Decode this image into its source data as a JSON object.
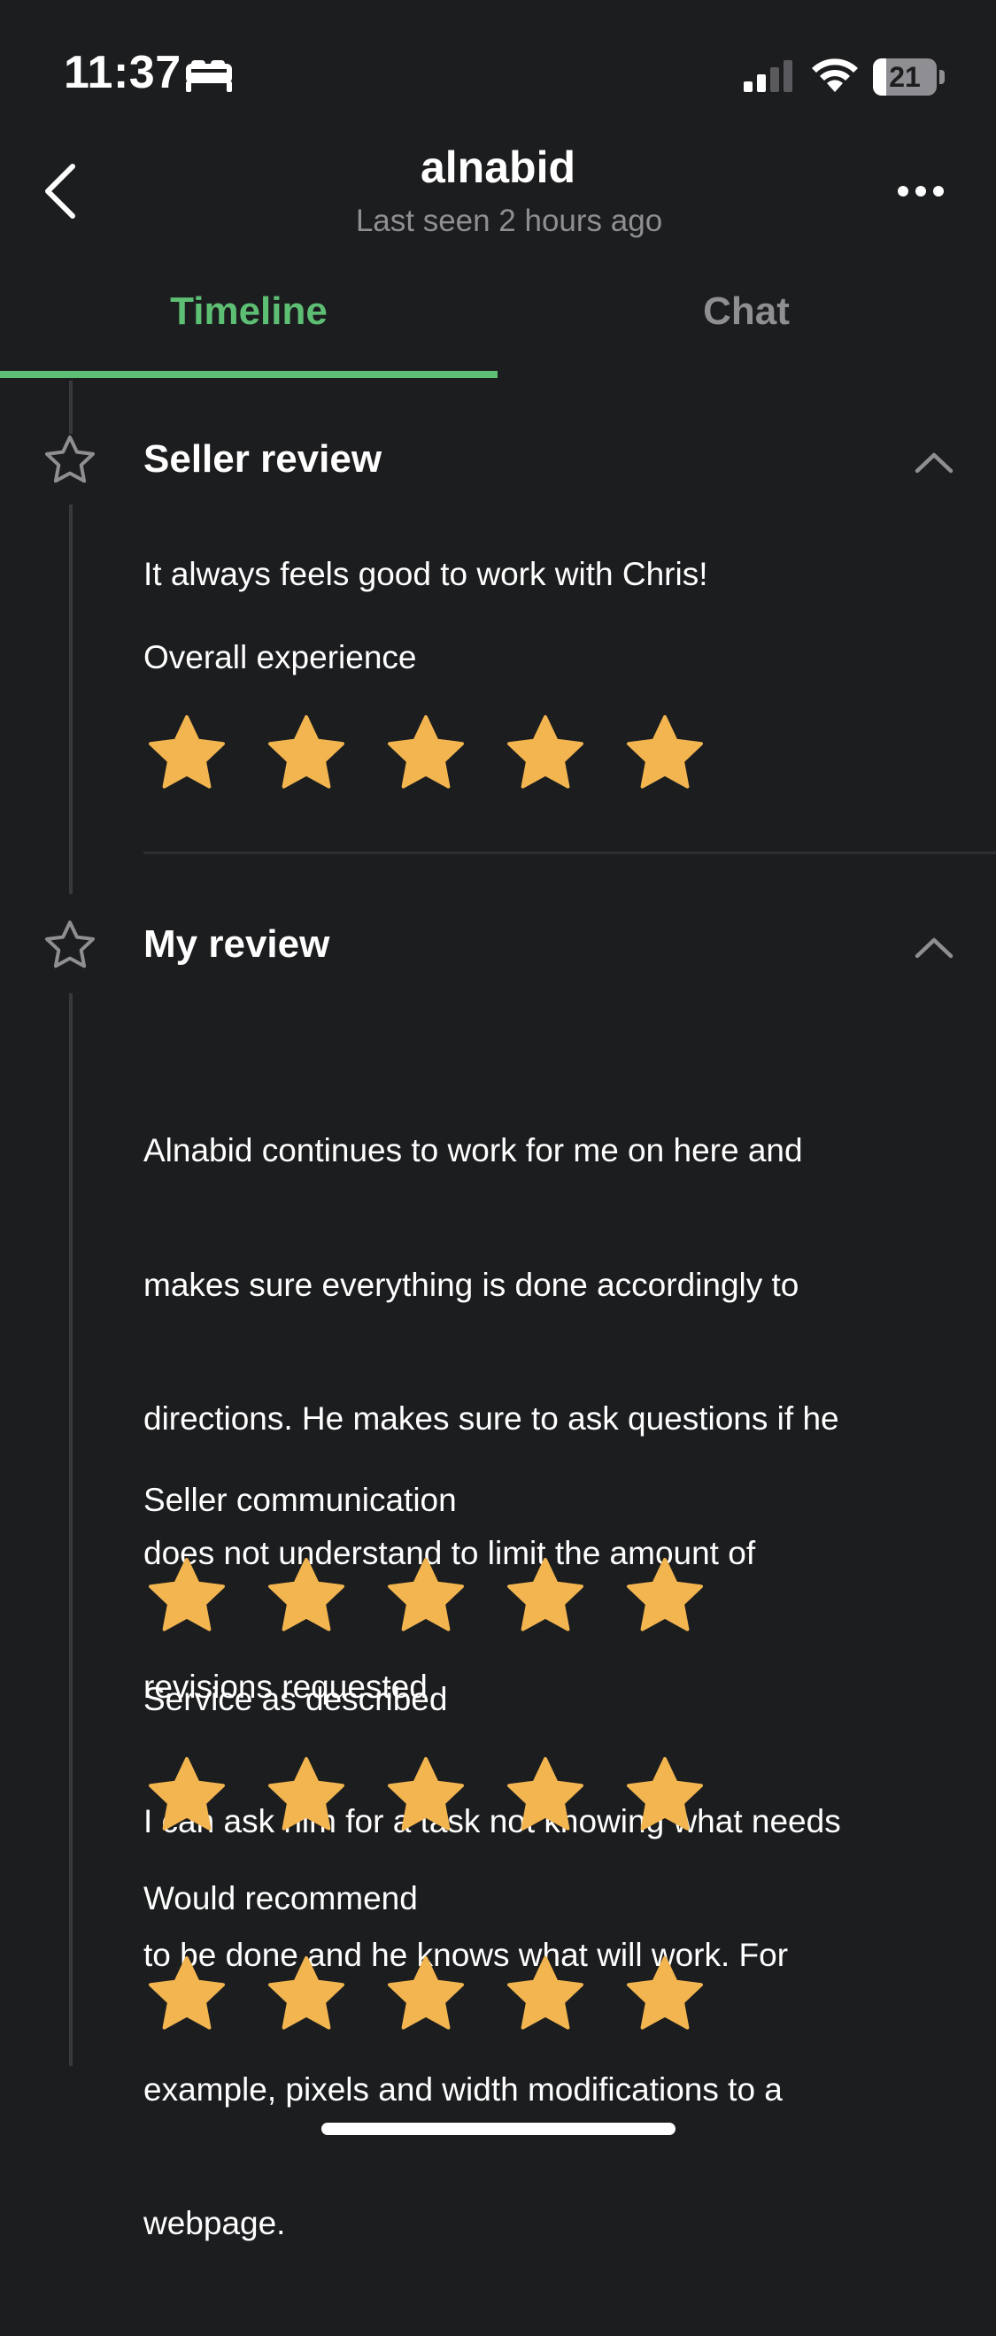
{
  "status_bar": {
    "time": "11:37",
    "battery_level": "21",
    "battery_fraction": 0.21,
    "icons": [
      "sleep-focus-icon",
      "cellular-signal-icon",
      "wifi-icon",
      "battery-icon"
    ]
  },
  "header": {
    "title": "alnabid",
    "subtitle": "Last seen 2 hours ago",
    "back_icon": "chevron-left-icon",
    "more_icon": "ellipsis-icon"
  },
  "tabs": [
    {
      "label": "Timeline",
      "active": true
    },
    {
      "label": "Chat",
      "active": false
    }
  ],
  "colors": {
    "accent": "#5dbf73",
    "star": "#f2b54f",
    "background": "#1c1d1f",
    "muted_text": "#8e8e93"
  },
  "seller_review": {
    "title": "Seller review",
    "text": "It always feels good to work with Chris!",
    "ratings": [
      {
        "label": "Overall experience",
        "stars": 5,
        "max": 5
      }
    ]
  },
  "my_review": {
    "title": "My review",
    "text_lines": [
      "Alnabid continues to work for me on here and",
      "makes sure everything is done accordingly to",
      "directions. He makes sure to ask questions if he",
      "does not understand to limit the amount of",
      "revisions requested",
      "I can ask him for a task not knowing what needs",
      "to be done and he knows what will work. For",
      "example, pixels and width modifications to a",
      "webpage."
    ],
    "ratings": [
      {
        "label": "Seller communication",
        "stars": 5,
        "max": 5
      },
      {
        "label": "Service as described",
        "stars": 5,
        "max": 5
      },
      {
        "label": "Would recommend",
        "stars": 5,
        "max": 5
      }
    ]
  }
}
